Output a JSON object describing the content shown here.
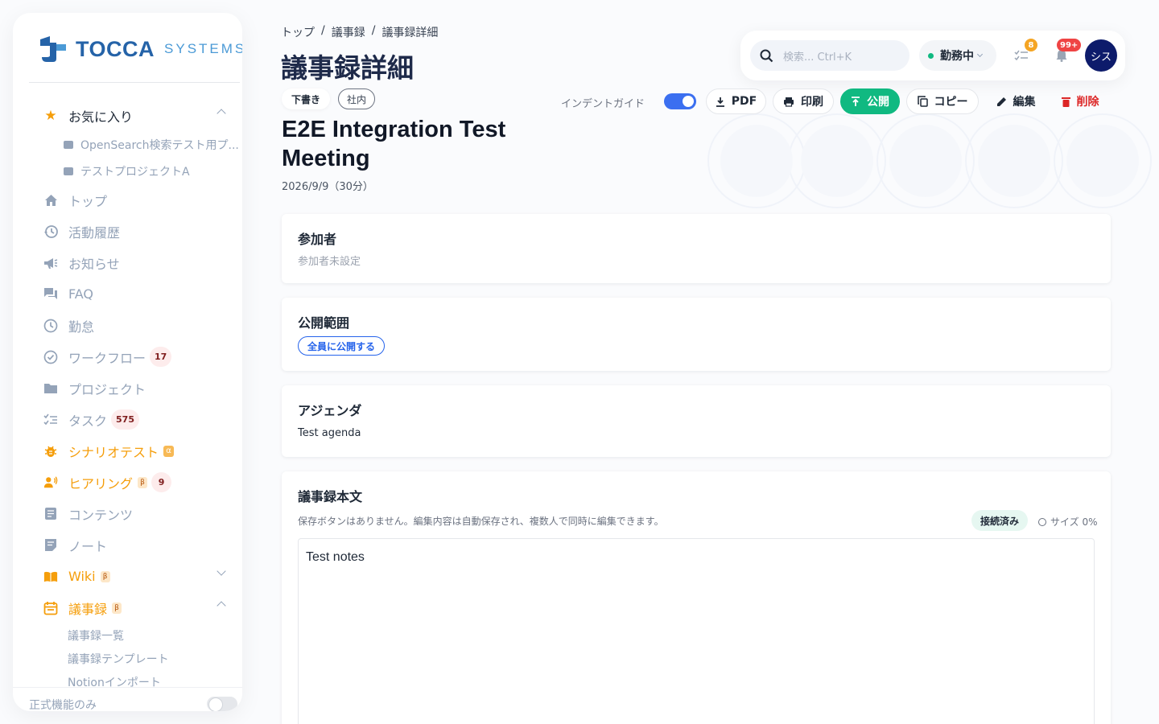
{
  "brand": {
    "name": "TOCCA",
    "sub": "SYSTEMS"
  },
  "sidebar": {
    "favorites": {
      "label": "お気に入り",
      "items": [
        "OpenSearch検索テスト用プ...",
        "テストプロジェクトA"
      ]
    },
    "items": [
      {
        "label": "トップ",
        "icon": "home-icon"
      },
      {
        "label": "活動履歴",
        "icon": "history-icon"
      },
      {
        "label": "お知らせ",
        "icon": "megaphone-icon"
      },
      {
        "label": "FAQ",
        "icon": "chat-icon"
      },
      {
        "label": "勤怠",
        "icon": "clock-icon"
      },
      {
        "label": "ワークフロー",
        "icon": "check-circle-icon",
        "count": "17"
      },
      {
        "label": "プロジェクト",
        "icon": "folder-icon"
      },
      {
        "label": "タスク",
        "icon": "tasklist-icon",
        "count": "575"
      },
      {
        "label": "シナリオテスト",
        "icon": "bug-icon",
        "tag": "α"
      },
      {
        "label": "ヒアリング",
        "icon": "speaker-icon",
        "tag": "β",
        "count": "9"
      },
      {
        "label": "コンテンツ",
        "icon": "document-icon"
      },
      {
        "label": "ノート",
        "icon": "note-icon"
      },
      {
        "label": "Wiki",
        "icon": "book-icon",
        "tag": "β"
      },
      {
        "label": "議事録",
        "icon": "calendar-icon",
        "tag": "β"
      }
    ],
    "minutes_sub": [
      "議事録一覧",
      "議事録テンプレート",
      "Notionインポート"
    ],
    "footer_label": "正式機能のみ"
  },
  "header": {
    "breadcrumb": [
      "トップ",
      "議事録",
      "議事録詳細"
    ],
    "title": "議事録詳細",
    "search_placeholder": "検索... Ctrl+K",
    "status": "勤務中",
    "task_badge": "8",
    "notif_badge": "99+",
    "avatar": "シス"
  },
  "toolbar": {
    "draft": "下書き",
    "internal": "社内",
    "indent_guide": "インデントガイド",
    "pdf": "PDF",
    "print": "印刷",
    "publish": "公開",
    "copy": "コピー",
    "edit": "編集",
    "delete": "削除"
  },
  "meeting": {
    "title": "E2E Integration Test Meeting",
    "date": "2026/9/9（30分）"
  },
  "cards": {
    "participants": {
      "title": "参加者",
      "empty": "参加者未設定"
    },
    "visibility": {
      "title": "公開範囲",
      "value": "全員に公開する"
    },
    "agenda": {
      "title": "アジェンダ",
      "text": "Test agenda"
    },
    "notes": {
      "title": "議事録本文",
      "hint": "保存ボタンはありません。編集内容は自動保存され、複数人で同時に編集できます。",
      "connected": "接続済み",
      "size": "サイズ 0%",
      "content": "Test notes"
    }
  },
  "colors": {
    "accent": "#10b981",
    "brand": "#2563a8",
    "orange": "#f59e0b",
    "danger": "#dc2626"
  }
}
